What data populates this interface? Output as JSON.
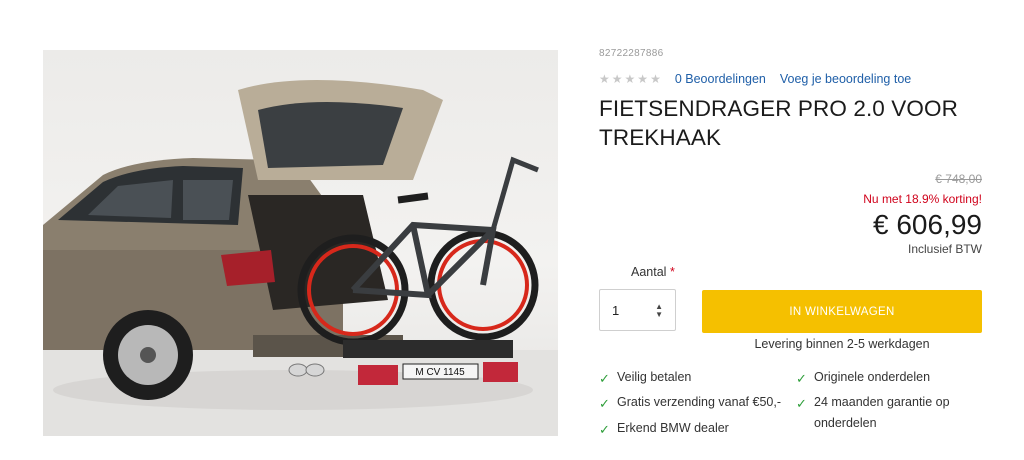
{
  "product": {
    "sku": "82722287886",
    "title_line1": "FIETSENDRAGER PRO 2.0 VOOR",
    "title_line2": "TREKHAAK",
    "image_plate_text": "M CV 1145"
  },
  "rating": {
    "stars": 5,
    "filled": 0,
    "reviews_link": "0 Beoordelingen",
    "add_review_link": "Voeg je beoordeling toe"
  },
  "price": {
    "old": "€ 748,00",
    "discount": "Nu met 18.9% korting!",
    "current": "€ 606,99",
    "vat_note": "Inclusief BTW"
  },
  "purchase": {
    "quantity_label": "Aantal",
    "required_mark": "*",
    "quantity_value": "1",
    "add_to_cart": "IN WINKELWAGEN",
    "delivery": "Levering binnen 2-5 werkdagen"
  },
  "usps": {
    "left": [
      "Veilig betalen",
      "Gratis verzending vanaf €50,-",
      "Erkend BMW dealer"
    ],
    "right_1": "Originele onderdelen",
    "right_2_line1": "24 maanden garantie op",
    "right_2_line2": "onderdelen"
  },
  "colors": {
    "accent": "#f5c000",
    "link": "#1f5fa8",
    "discount": "#d0021b",
    "check": "#2e9e3a"
  }
}
